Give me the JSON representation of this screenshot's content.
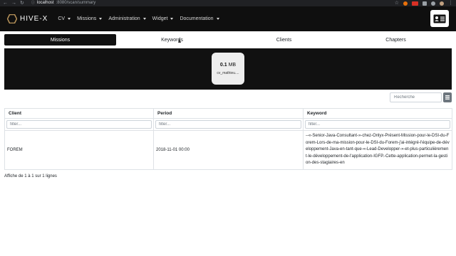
{
  "browser": {
    "url_host": "localhost",
    "url_path": ":8080/scan/summary"
  },
  "navbar": {
    "brand": "HIVE-X",
    "menu": [
      {
        "label": "CV"
      },
      {
        "label": "Missions"
      },
      {
        "label": "Administration"
      },
      {
        "label": "Widget"
      },
      {
        "label": "Documentation"
      }
    ]
  },
  "tabs": [
    {
      "label": "Missions",
      "active": true
    },
    {
      "label": "Keywords",
      "active": false
    },
    {
      "label": "Clients",
      "active": false
    },
    {
      "label": "Chapters",
      "active": false
    }
  ],
  "card": {
    "size_value": "0.1",
    "size_unit": "MB",
    "name": "cv_mathieu...."
  },
  "search": {
    "placeholder": "Recherche"
  },
  "table": {
    "columns": [
      "Client",
      "Period",
      "Keyword"
    ],
    "filter_placeholder": "filter...",
    "rows": [
      {
        "client": "FOREM",
        "period": "2018-11-01 00:00",
        "keyword": "--«-Senior-Java-Consultant-»-chez-Onlyx-Présent-Mission-pour-le-DSI-du-Forem-Lors-de-ma-mission-pour-le-DSI-du-Forem-j'ai-intégré-l'équipe-de-développement-Java-en-tant-que-«-Lead-Developper-»-et-plus-particulièrement-le-développement-de-l'application-IGFP.-Cette-application-permet-la-gestion-des-stagiaires-en"
      }
    ]
  },
  "footer": {
    "info": "Affiche de 1 à 1 sur 1 lignes"
  }
}
